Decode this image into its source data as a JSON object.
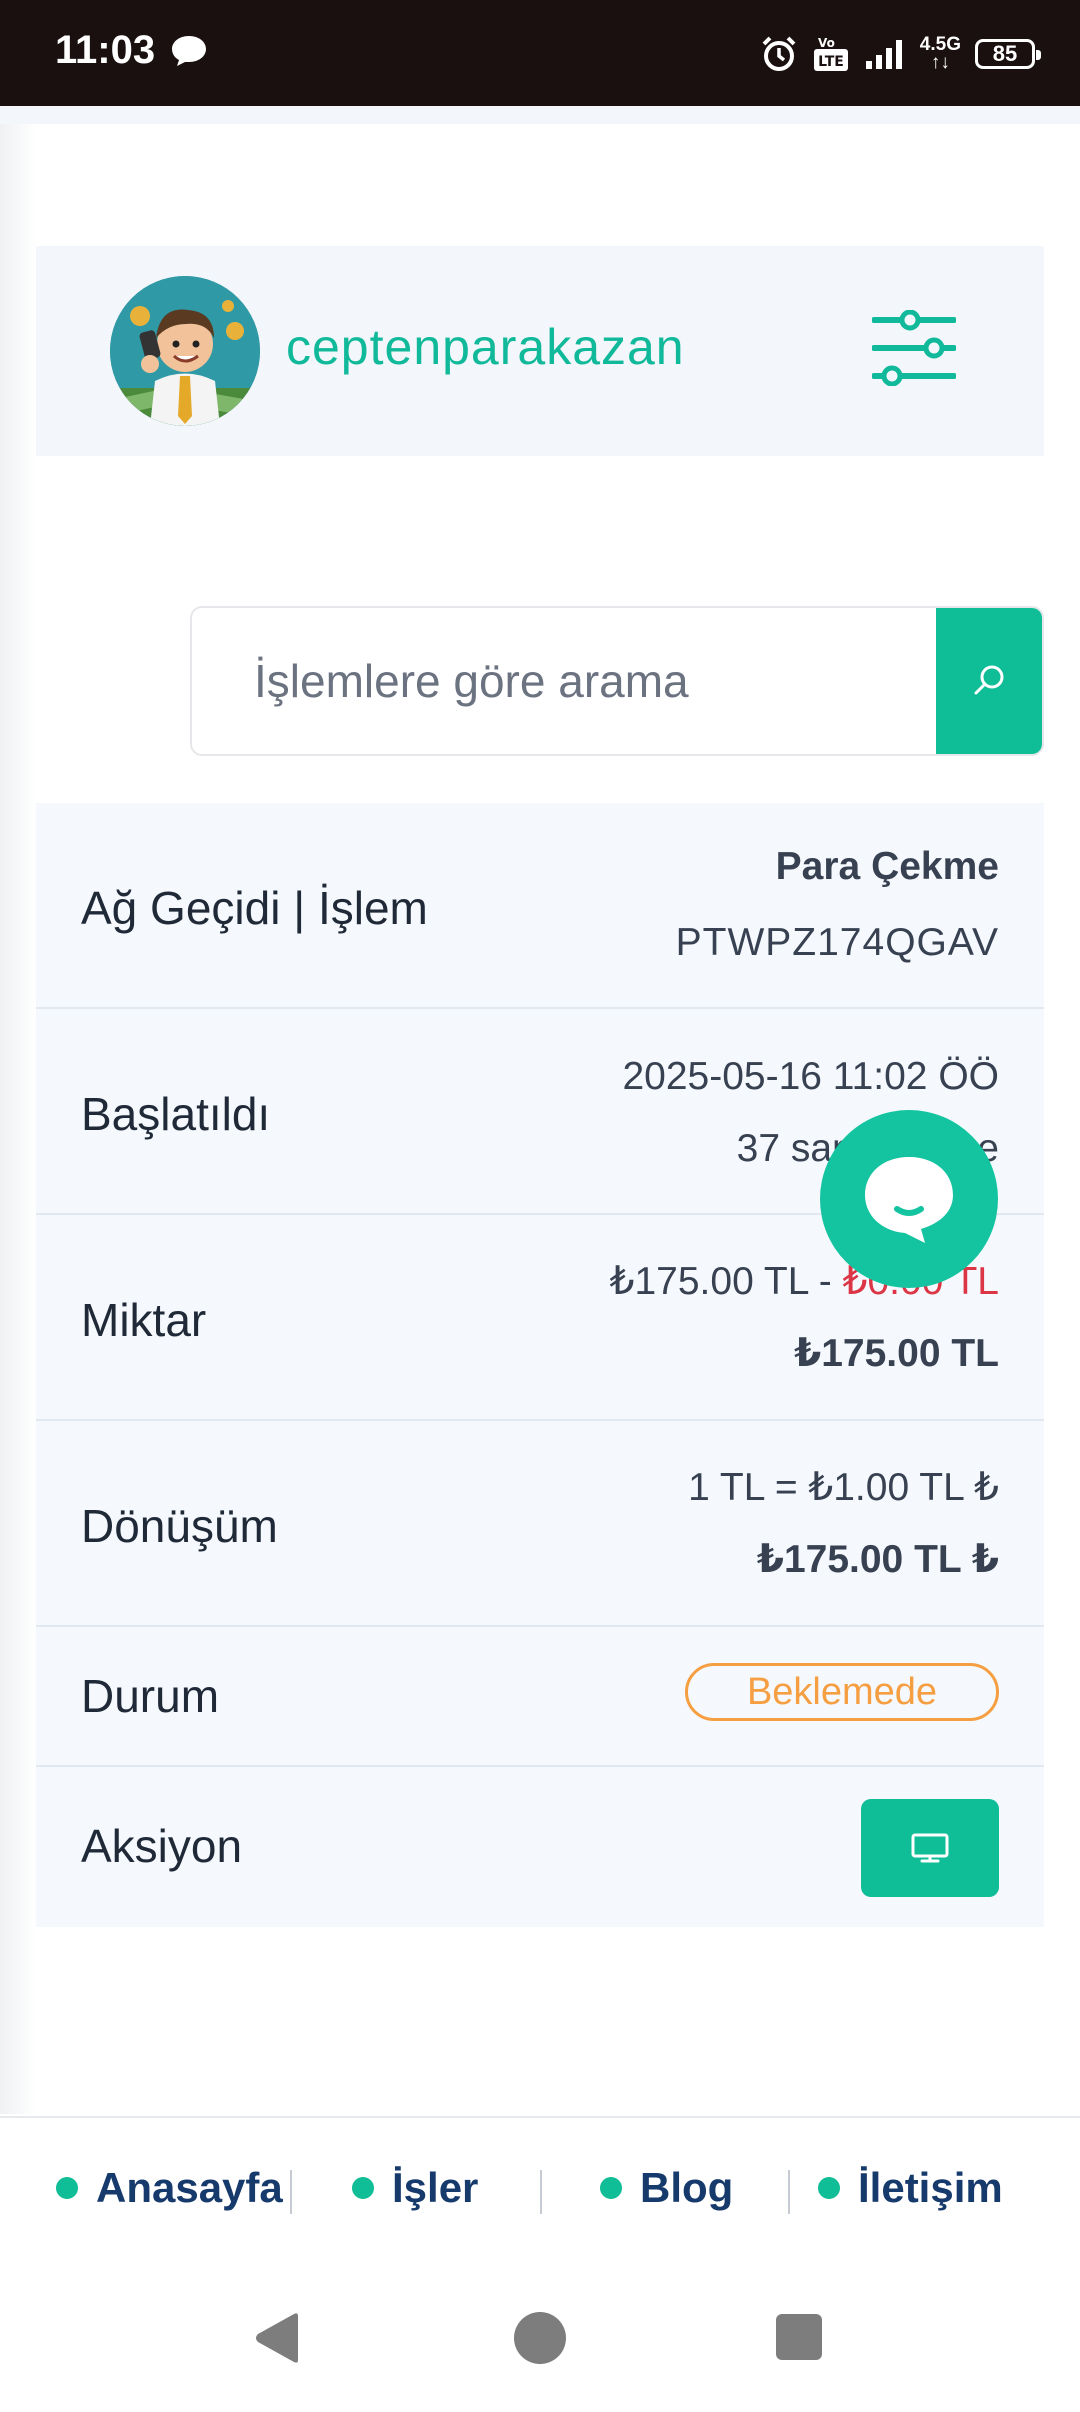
{
  "status_bar": {
    "time": "11:03",
    "network": "4.5G",
    "battery": "85",
    "icons": [
      "chat-bubble-icon",
      "alarm-icon",
      "volte-icon",
      "signal-icon",
      "battery-icon"
    ]
  },
  "header": {
    "brand": "ceptenparakazan",
    "avatar_icon": "cartoon-businessman-avatar",
    "menu_icon": "sliders-icon"
  },
  "search": {
    "placeholder": "İşlemlere göre arama",
    "button_icon": "search-icon"
  },
  "transaction": {
    "rows": [
      {
        "label": "Ağ Geçidi | İşlem",
        "line1": "Para Çekme",
        "line2": "PTWPZ174QGAV"
      },
      {
        "label": "Başlatıldı",
        "line1": "2025-05-16 11:02 ÖÖ",
        "line2": "37 saniye önce"
      },
      {
        "label": "Miktar",
        "line1_amount": "₺175.00 TL",
        "line1_sep": " - ",
        "line1_fee": "₺0.00 TL",
        "line2": "₺175.00 TL"
      },
      {
        "label": "Dönüşüm",
        "line1": "1 TL = ₺1.00 TL ₺",
        "line2": "₺175.00 TL ₺"
      },
      {
        "label": "Durum",
        "badge": "Beklemede"
      },
      {
        "label": "Aksiyon",
        "button_icon": "monitor-icon"
      }
    ]
  },
  "chat_fab_icon": "chat-icon",
  "bottom_nav": {
    "items": [
      {
        "label": "Anasayfa"
      },
      {
        "label": "İşler"
      },
      {
        "label": "Blog"
      },
      {
        "label": "İletişim"
      }
    ]
  },
  "colors": {
    "accent": "#0fbd96",
    "status_pending": "#f59e42",
    "fee_red": "#dc3545",
    "nav_text": "#163a6b"
  }
}
